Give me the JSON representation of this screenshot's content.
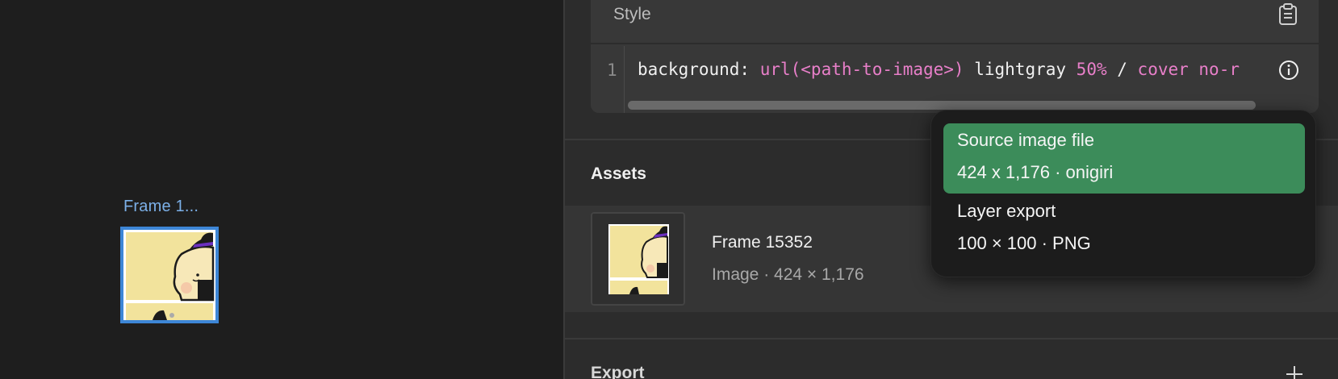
{
  "canvas": {
    "frame_label": "Frame 1..."
  },
  "style_section": {
    "title": "Style",
    "line_number": "1",
    "code": {
      "property": "background: ",
      "fn": "url(<path-to-image>)",
      "space1": " lightgray ",
      "num": "50%",
      "slash": " / ",
      "rest": "cover no-r"
    }
  },
  "assets_section": {
    "title": "Assets",
    "item": {
      "name": "Frame 15352",
      "meta": "Image · 424 × 1,176"
    }
  },
  "export_section": {
    "title": "Export"
  },
  "popover": {
    "items": [
      {
        "title": "Source image file",
        "subtitle": "424 x 1,176 · onigiri",
        "selected": true
      },
      {
        "title": "Layer export",
        "subtitle": "100 × 100 · PNG",
        "selected": false
      }
    ]
  },
  "colors": {
    "selection_blue": "#3d86d6",
    "frame_label_blue": "#7cb0e8",
    "selected_green": "#3c8c5a",
    "code_accent_pink": "#e87fc9",
    "panel_bg": "#2c2c2c",
    "canvas_bg": "#1e1e1e"
  },
  "icons": {
    "clipboard": "clipboard-icon",
    "info": "info-icon",
    "add": "plus-icon"
  }
}
